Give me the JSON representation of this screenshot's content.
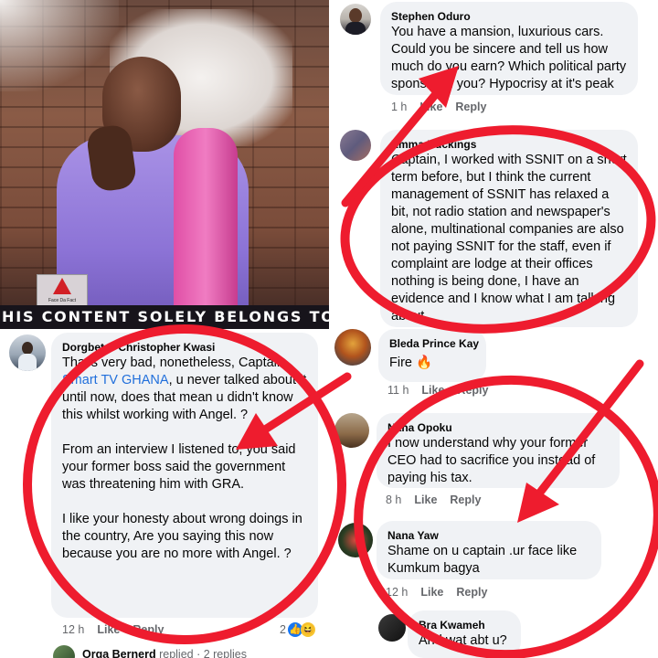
{
  "video": {
    "ticker": "HIS CONTENT SOLELY BELONGS TO S",
    "logo_text": "Face Da Fact"
  },
  "comments": [
    {
      "author": "Stephen Oduro",
      "text": "You have a mansion, luxurious cars. Could you be sincere and tell us how much do you earn? Which political party sponsored you? Hypocrisy at it's peak",
      "time": "1 h",
      "like": "Like",
      "reply": "Reply"
    },
    {
      "author": "Emma Buckings",
      "text": "Captain, I worked with SSNIT on a short term before, but I think the current management of SSNIT has relaxed a bit, not radio station and newspaper's alone, multinational companies are also not paying SSNIT for the staff, even if complaint are lodge at their offices nothing is being done, I have an evidence and I know what I am talking about"
    },
    {
      "author": "Bleda Prince Kay",
      "text": "Fire 🔥",
      "time": "11 h",
      "like": "Like",
      "reply": "Reply"
    },
    {
      "author": "Dorgbetor Christopher Kwasi",
      "text_prefix": "That's very bad, nonetheless, Captain",
      "link": "Smart TV GHANA",
      "text_rest": ", u never talked about it until now, does that mean u didn't know this whilst working with Angel. ?",
      "para2": "From an interview I listened to, you said your former boss said the government was threatening him with GRA.",
      "para3": "I like your honesty about wrong doings in the country,   Are you saying this now because you are no more with Angel. ?",
      "time": "12 h",
      "like": "Like",
      "reply": "Reply",
      "reaction_count": "2"
    },
    {
      "author": "Nana Opoku",
      "text": "I now understand why your former CEO had to sacrifice you instead of paying his tax.",
      "time": "8 h",
      "like": "Like",
      "reply": "Reply"
    },
    {
      "author": "Nana Yaw",
      "text": "Shame on u captain .ur face like Kumkum bagya",
      "time": "12 h",
      "like": "Like",
      "reply": "Reply"
    },
    {
      "author": "Bra Kwameh",
      "text": "And wat abt u?"
    }
  ],
  "replies_link": {
    "author": "Orga Bernerd",
    "text": "replied · 2 replies"
  },
  "colors": {
    "annotation_red": "#ee1c2e",
    "bubble_bg": "#f0f2f5",
    "link_blue": "#216fdb",
    "meta_gray": "#65676b"
  }
}
